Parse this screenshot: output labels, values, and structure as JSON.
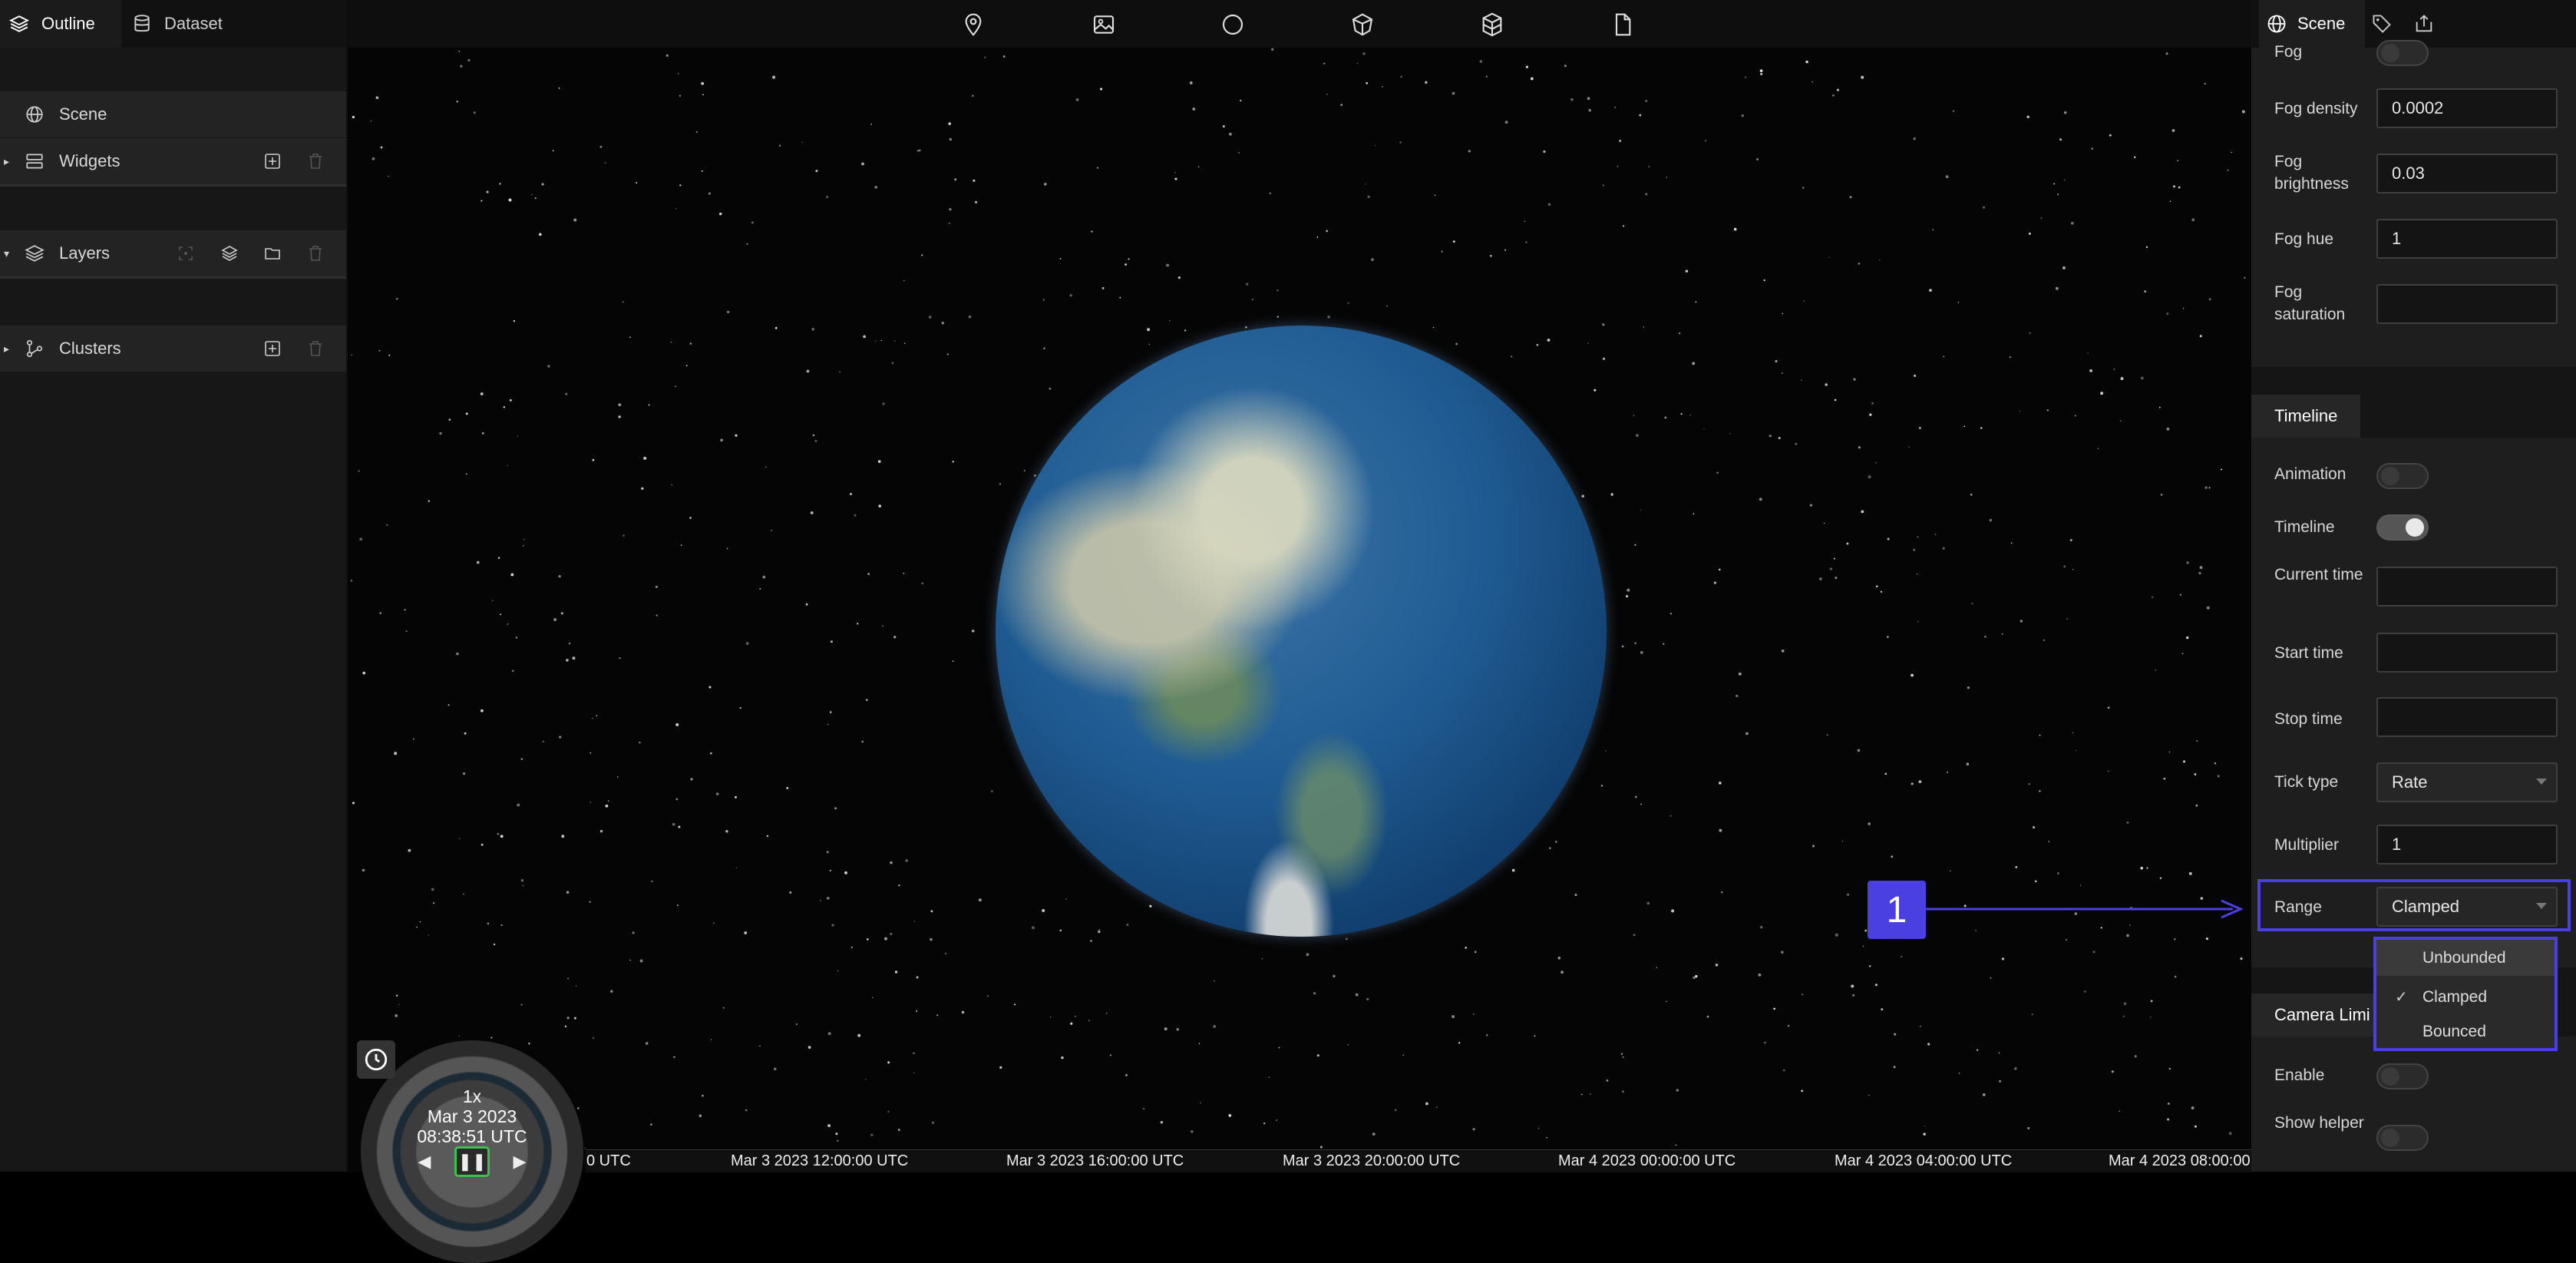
{
  "left_panel": {
    "tabs": [
      {
        "label": "Outline",
        "icon": "layers-icon",
        "active": true
      },
      {
        "label": "Dataset",
        "icon": "database-icon",
        "active": false
      }
    ],
    "tree": {
      "scene": "Scene",
      "widgets": "Widgets",
      "layers": "Layers",
      "clusters": "Clusters"
    }
  },
  "toolbar": {
    "tools": [
      "map-pin-icon",
      "image-icon",
      "circle-icon",
      "cube-icon",
      "model-icon",
      "file-icon"
    ]
  },
  "timeline": {
    "speed": "1x",
    "date": "Mar 3 2023",
    "time": "08:38:51 UTC",
    "ticks": [
      "0 UTC",
      "Mar 3 2023 12:00:00 UTC",
      "Mar 3 2023 16:00:00 UTC",
      "Mar 3 2023 20:00:00 UTC",
      "Mar 4 2023 00:00:00 UTC",
      "Mar 4 2023 04:00:00 UTC",
      "Mar 4 2023 08:00:00"
    ]
  },
  "annotation": {
    "number": "1",
    "color": "#4a3fe0"
  },
  "right_panel": {
    "tabs": [
      {
        "label": "Scene",
        "icon": "globe-icon",
        "active": true
      },
      {
        "label": "",
        "icon": "tag-icon",
        "active": false
      },
      {
        "label": "",
        "icon": "publish-icon",
        "active": false
      }
    ],
    "fog": {
      "fog_label": "Fog",
      "density_label": "Fog density",
      "density_value": "0.0002",
      "brightness_label": "Fog brightness",
      "brightness_value": "0.03",
      "hue_label": "Fog hue",
      "hue_value": "1",
      "saturation_label": "Fog saturation",
      "saturation_value": ""
    },
    "timeline_section": {
      "title": "Timeline",
      "animation_label": "Animation",
      "timeline_label": "Timeline",
      "current_time_label": "Current time",
      "current_time_value": "",
      "start_time_label": "Start time",
      "start_time_value": "",
      "stop_time_label": "Stop time",
      "stop_time_value": "",
      "tick_type_label": "Tick type",
      "tick_type_value": "Rate",
      "multiplier_label": "Multiplier",
      "multiplier_value": "1",
      "range_label": "Range",
      "range_value": "Clamped",
      "range_options": [
        "Unbounded",
        "Clamped",
        "Bounced"
      ]
    },
    "camera_section": {
      "title": "Camera Limi",
      "enable_label": "Enable",
      "show_helper_label": "Show helper"
    }
  }
}
